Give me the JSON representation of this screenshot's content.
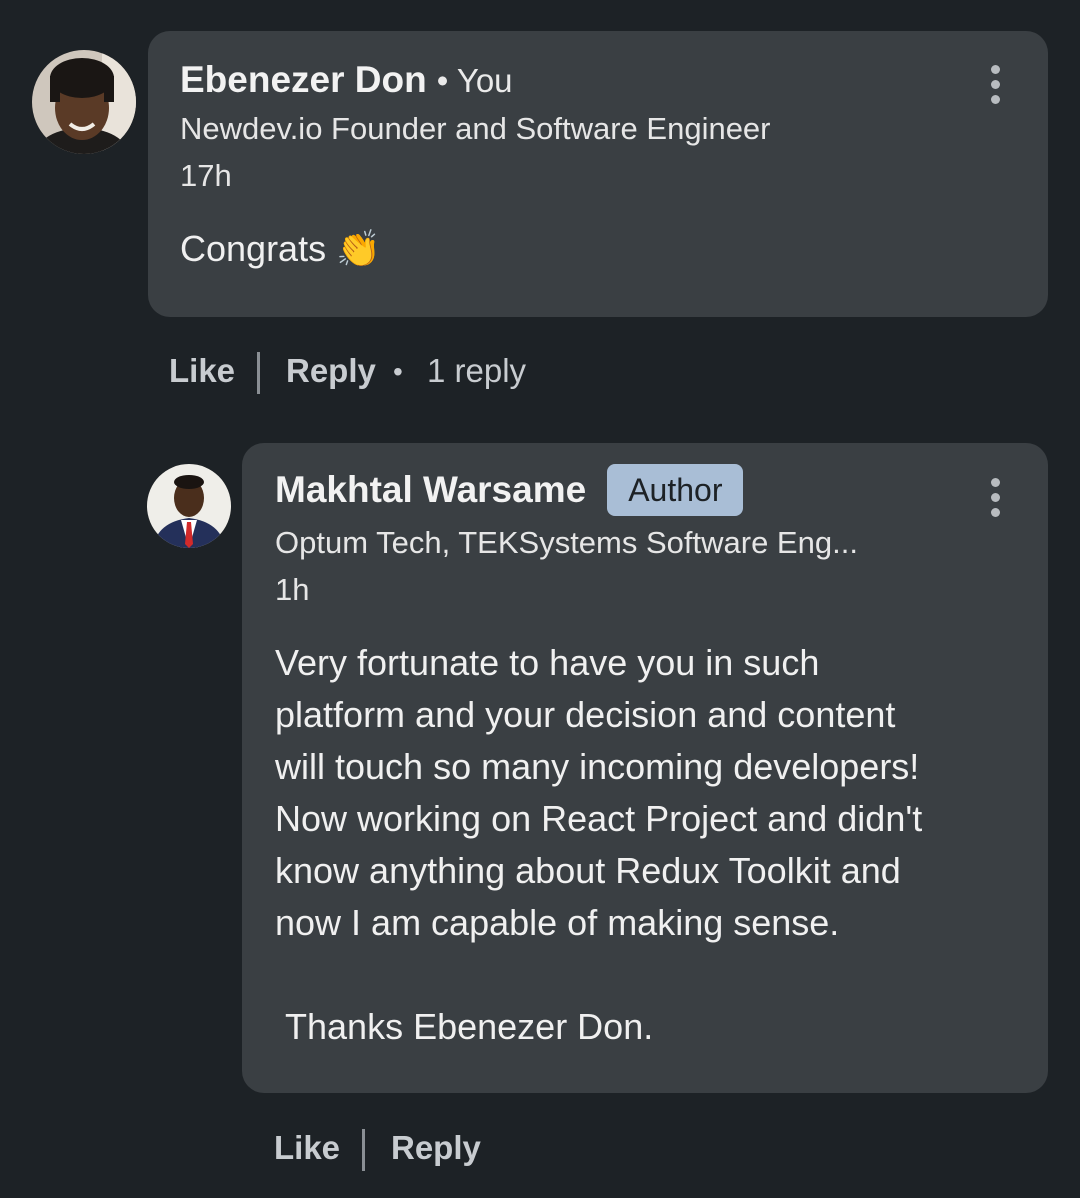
{
  "comment": {
    "author_name": "Ebenezer Don",
    "you_label": "• You",
    "headline": "Newdev.io Founder and Software Engineer",
    "time": "17h",
    "text": "Congrats 👏",
    "actions": {
      "like": "Like",
      "reply": "Reply",
      "separator": "•",
      "reply_count": "1 reply"
    }
  },
  "reply": {
    "author_name": "Makhtal Warsame",
    "badge": "Author",
    "headline": "Optum Tech, TEKSystems Software Eng...",
    "time": "1h",
    "text": "Very fortunate to have you in such\nplatform and your decision and content\nwill touch so many incoming developers!\nNow working on React Project and didn't\nknow anything about Redux Toolkit and\nnow I am capable of making sense.\n\n Thanks Ebenezer Don.",
    "actions": {
      "like": "Like",
      "reply": "Reply"
    }
  },
  "colors": {
    "background": "#1d2226",
    "card": "#3a3f43",
    "badge": "#a9bed6"
  }
}
